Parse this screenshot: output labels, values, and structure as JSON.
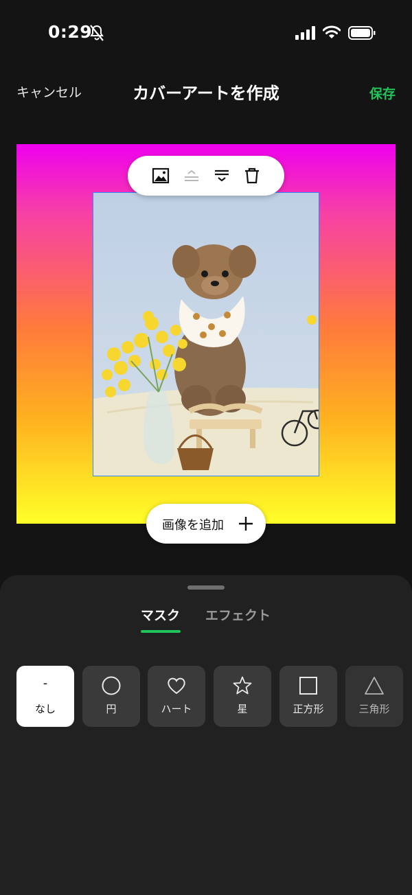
{
  "status_bar": {
    "time": "0:29"
  },
  "header": {
    "cancel_label": "キャンセル",
    "title": "カバーアートを作成",
    "save_label": "保存"
  },
  "toolbar": {
    "icons": [
      "image-icon",
      "bring-forward-icon",
      "arrange-icon",
      "trash-icon"
    ]
  },
  "add_image": {
    "label": "画像を追加"
  },
  "tabs": [
    {
      "label": "マスク",
      "active": true
    },
    {
      "label": "エフェクト",
      "active": false
    }
  ],
  "mask_options": [
    {
      "icon": "-",
      "label": "なし",
      "selected": true
    },
    {
      "icon": "circle",
      "label": "円"
    },
    {
      "icon": "heart",
      "label": "ハート"
    },
    {
      "icon": "star",
      "label": "星"
    },
    {
      "icon": "square",
      "label": "正方形"
    },
    {
      "icon": "triangle",
      "label": "三角形"
    }
  ],
  "colors": {
    "accent": "#21c45a",
    "selection_border": "#2d8bff"
  }
}
